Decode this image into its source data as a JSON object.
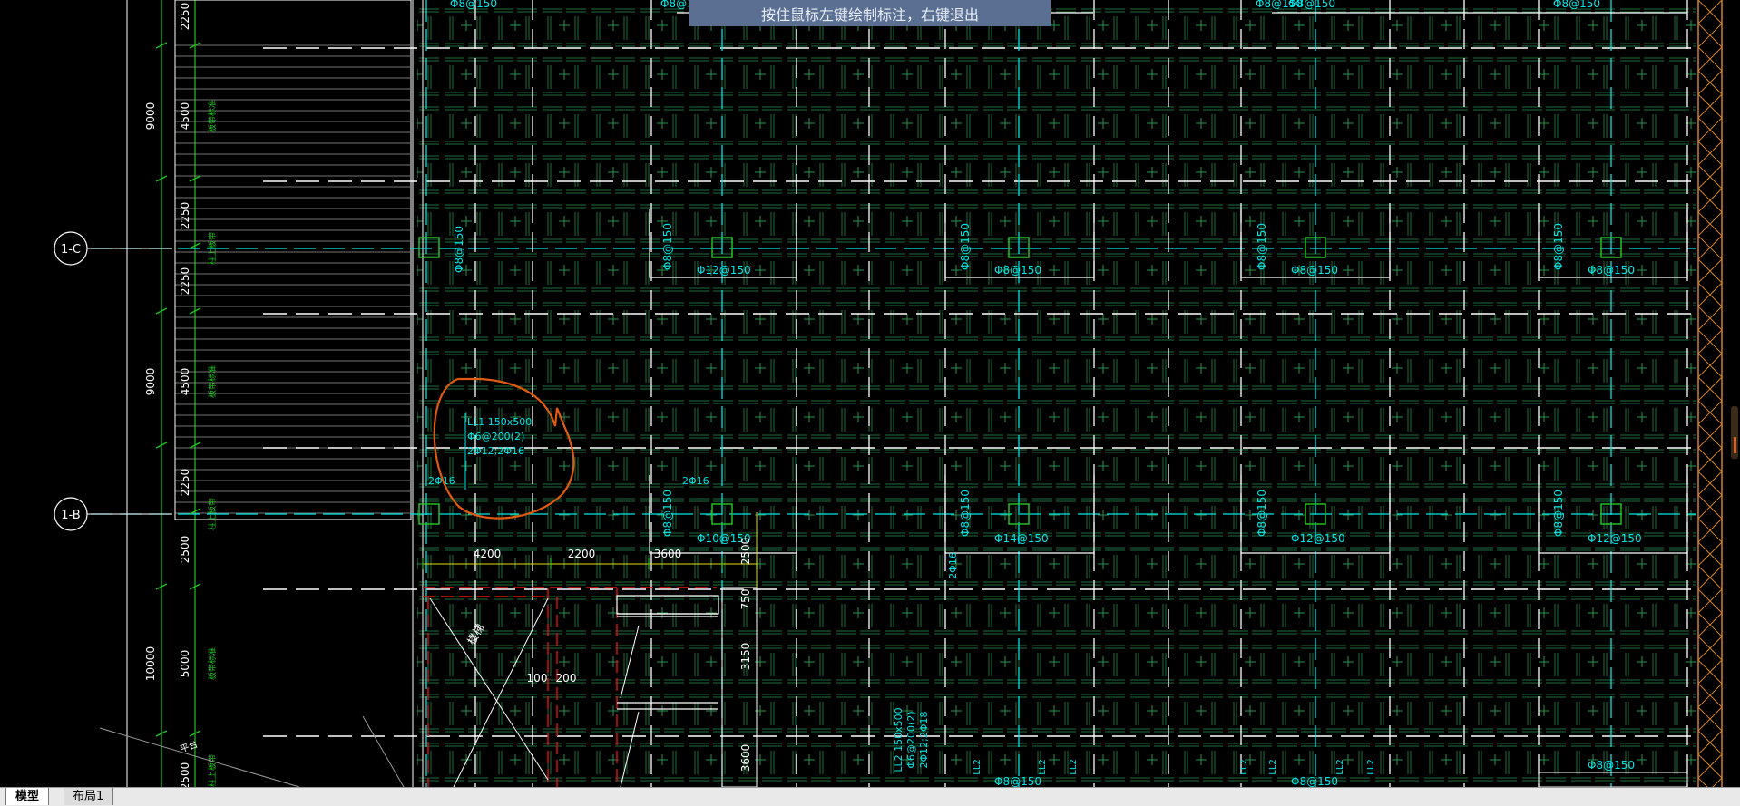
{
  "prompt": "按住鼠标左键绘制标注，右键退出",
  "tabs": {
    "model": "模型",
    "layout1": "布局1"
  },
  "axis_labels": {
    "c": "1-C",
    "b": "1-B"
  },
  "left_dims_total": [
    "9000",
    "9000",
    "10000"
  ],
  "left_dims_sub": [
    "2250",
    "4500",
    "2250",
    "2250",
    "4500",
    "2250",
    "2500",
    "5000",
    "2500"
  ],
  "green_tags": [
    "板带标准",
    "柱上板带",
    "板带标准",
    "柱上板带",
    "板带标准",
    "柱上板带"
  ],
  "rebar_col_top": [
    "Φ8@150",
    "Φ8@150",
    "Φ8@150",
    "Φ8@150",
    "Φ8@150",
    "Φ8@150",
    "Φ8@150"
  ],
  "rebar_row_upper": [
    "Φ8@150",
    "Φ8@150",
    "Φ8@150",
    "Φ8@150"
  ],
  "rebar_row_upper_h": [
    "Φ12@150",
    "Φ8@150",
    "Φ8@150",
    "Φ8@150"
  ],
  "rebar_row_lower": [
    "Φ8@150",
    "Φ8@150",
    "Φ8@150",
    "Φ8@150"
  ],
  "rebar_row_lower_h": [
    "Φ10@150",
    "Φ14@150",
    "Φ12@150",
    "Φ12@150"
  ],
  "beam1": {
    "l1": "LL1 150x500",
    "l2": "Φ6@200(2)",
    "l3": "2Φ12;2Φ16"
  },
  "beam2": {
    "l1": "LL2 150x500",
    "l2": "Φ6@200(2)",
    "l3": "2Φ12;2Φ18"
  },
  "small_marks": {
    "a": "2Φ16",
    "b": "2Φ16",
    "c": "2Φ16"
  },
  "bottom_dims": [
    "4200",
    "2200",
    "3600"
  ],
  "bottom_vdims": [
    "2500",
    "750",
    "3150",
    "3600"
  ],
  "stair_dims": [
    "100",
    "200"
  ],
  "ll2_tags": [
    "LL2",
    "LL2",
    "LL2",
    "LL2",
    "LL2",
    "LL2",
    "LL2",
    "LL2"
  ],
  "bottom_rebar": [
    "Φ8@150",
    "Φ8@150",
    "Φ8@150"
  ],
  "misc": {
    "stair": "楼梯",
    "landing": "平台"
  },
  "colors": {
    "cyan": "#00e5e5",
    "green": "#22c022",
    "white": "#ffffff",
    "red": "#e01010",
    "orange": "#e05a10",
    "yellow": "#e0e000"
  }
}
